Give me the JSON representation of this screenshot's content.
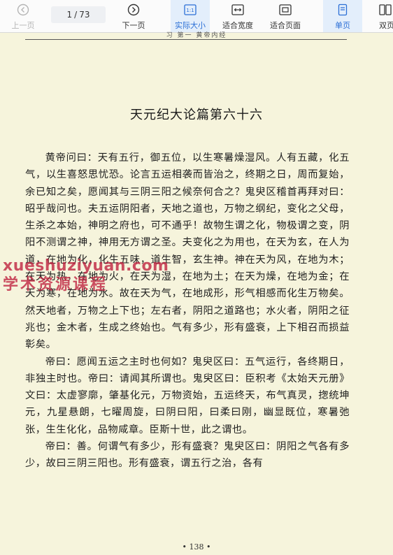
{
  "toolbar": {
    "prev_label": "上一页",
    "next_label": "下一页",
    "current_page": "1",
    "page_separator": "/",
    "total_pages": "73",
    "actual_size_label": "实际大小",
    "actual_size_icon_text": "1:1",
    "fit_width_label": "适合宽度",
    "fit_page_label": "适合页面",
    "single_page_label": "单页",
    "double_page_label": "双页"
  },
  "document": {
    "running_head": "习 第一 黄帝内经",
    "chapter_title": "天元纪大论篇第六十六",
    "paragraphs": [
      "黄帝问曰：天有五行，御五位，以生寒暑燥湿风。人有五藏，化五气，以生喜怒思忧恐。论言五运相袭而皆治之，终期之日，周而复始，余已知之矣，愿闻其与三阴三阳之候奈何合之？鬼臾区稽首再拜对曰：昭乎哉问也。夫五运阴阳者，天地之道也，万物之纲纪，变化之父母，生杀之本始，神明之府也，可不通乎！故物生谓之化，物极谓之变，阴阳不测谓之神，神用无方谓之圣。夫变化之为用也，在天为玄，在人为道，在地为化，化生五味，道生智，玄生神。神在天为风，在地为木；在天为热，在地为火，在天为湿，在地为土；在天为燥，在地为金；在天为寒，在地为水。故在天为气，在地成形，形气相感而化生万物矣。然天地者，万物之上下也；左右者，阴阳之道路也；水火者，阴阳之征兆也；金木者，生成之终始也。气有多少，形有盛衰，上下相召而损益彰矣。",
      "帝曰：愿闻五运之主时也何如？鬼臾区曰：五气运行，各终期日，非独主时也。帝曰：请闻其所谓也。鬼臾区曰：臣积考《太始天元册》文曰：太虚寥廓，肇基化元，万物资始，五运终天，布气真灵，揔统坤元，九星悬朗，七曜周旋，曰阴曰阳，曰柔曰刚，幽显既位，寒暑弛张，生生化化，品物咸章。臣斯十世，此之谓也。",
      "帝曰：善。何谓气有多少，形有盛衰？鬼臾区曰：阴阳之气各有多少，故曰三阴三阳也。形有盛衰，谓五行之治，各有"
    ],
    "page_number": "• 138 •"
  },
  "watermark": {
    "line1": "xueshuziyuan.com",
    "line2": "学术资源课程"
  },
  "colors": {
    "page_background": "#f6f4dc",
    "active_accent": "#2b6fd6",
    "active_background": "#e3eefb",
    "watermark": "#be1e3c"
  }
}
